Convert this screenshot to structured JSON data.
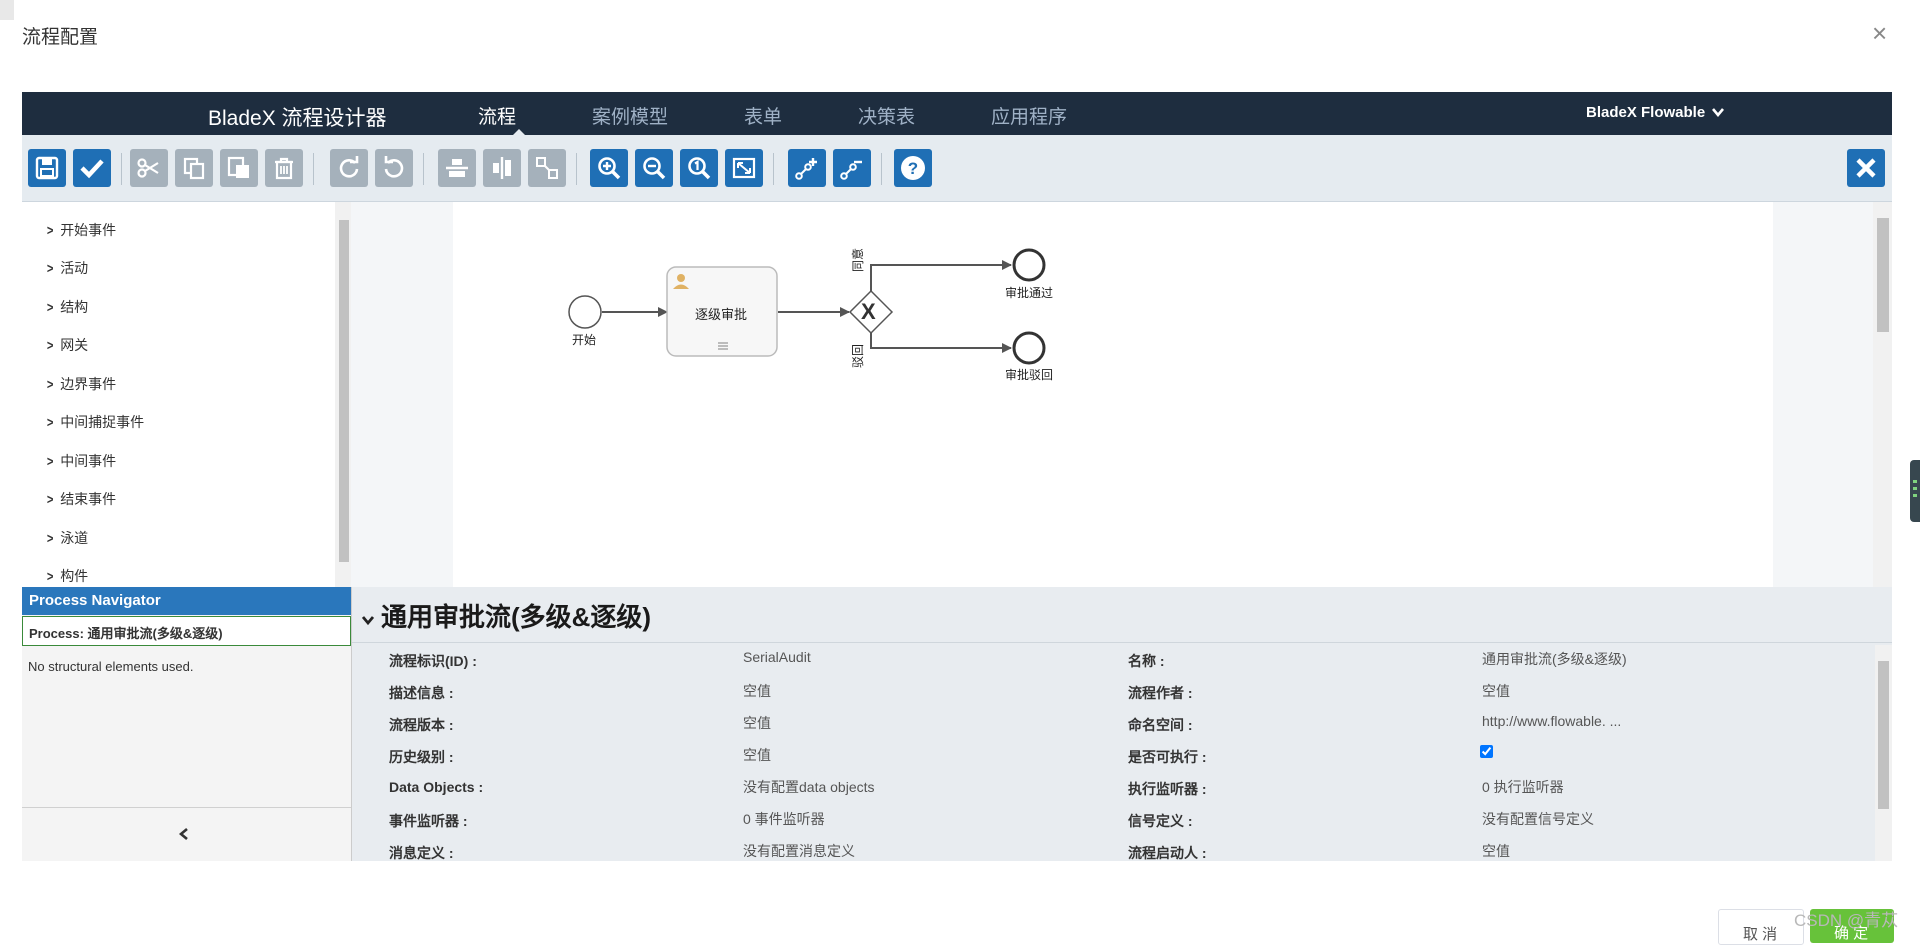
{
  "dialog": {
    "title": "流程配置",
    "close_symbol": "×"
  },
  "topnav": {
    "brand": "BladeX 流程设计器",
    "tabs": [
      {
        "label": "流程",
        "active": true
      },
      {
        "label": "案例模型",
        "active": false
      },
      {
        "label": "表单",
        "active": false
      },
      {
        "label": "决策表",
        "active": false
      },
      {
        "label": "应用程序",
        "active": false
      }
    ],
    "right_menu": "BladeX Flowable",
    "right_menu_icon": "chevron-down-icon"
  },
  "toolbar": {
    "buttons": [
      {
        "name": "save-icon",
        "state": "enabled"
      },
      {
        "name": "validate-check-icon",
        "state": "enabled"
      },
      {
        "name": "cut-icon",
        "state": "disabled"
      },
      {
        "name": "copy-icon",
        "state": "disabled"
      },
      {
        "name": "paste-icon",
        "state": "disabled"
      },
      {
        "name": "delete-icon",
        "state": "disabled"
      },
      {
        "name": "redo-icon",
        "state": "disabled"
      },
      {
        "name": "undo-icon",
        "state": "disabled"
      },
      {
        "name": "align-horizontal-icon",
        "state": "disabled"
      },
      {
        "name": "align-vertical-icon",
        "state": "disabled"
      },
      {
        "name": "same-size-icon",
        "state": "disabled"
      },
      {
        "name": "zoom-in-icon",
        "state": "enabled"
      },
      {
        "name": "zoom-out-icon",
        "state": "enabled"
      },
      {
        "name": "zoom-actual-icon",
        "state": "enabled"
      },
      {
        "name": "zoom-fit-icon",
        "state": "enabled"
      },
      {
        "name": "add-bendpoint-icon",
        "state": "enabled"
      },
      {
        "name": "remove-bendpoint-icon",
        "state": "enabled"
      },
      {
        "name": "help-icon",
        "state": "enabled"
      },
      {
        "name": "close-editor-icon",
        "state": "enabled"
      }
    ]
  },
  "palette": {
    "groups": [
      "开始事件",
      "活动",
      "结构",
      "网关",
      "边界事件",
      "中间捕捉事件",
      "中间事件",
      "结束事件",
      "泳道",
      "构件"
    ]
  },
  "diagram": {
    "start_label": "开始",
    "task_label": "逐级审批",
    "approve_flow_label": "同意",
    "reject_flow_label": "驳回",
    "end_approved_label": "审批通过",
    "end_rejected_label": "审批驳回",
    "gateway_symbol": "X"
  },
  "navigator": {
    "header": "Process Navigator",
    "process_label": "Process: 通用审批流(多级&逐级)",
    "empty_text": "No structural elements used.",
    "collapse_symbol": "‹"
  },
  "properties": {
    "title": "通用审批流(多级&逐级)",
    "left": [
      {
        "label": "流程标识(ID) :",
        "value": "SerialAudit"
      },
      {
        "label": "描述信息 :",
        "value": "空值"
      },
      {
        "label": "流程版本 :",
        "value": "空值"
      },
      {
        "label": "历史级别 :",
        "value": "空值"
      },
      {
        "label": "Data Objects :",
        "value": "没有配置data objects"
      },
      {
        "label": "事件监听器 :",
        "value": "0 事件监听器"
      },
      {
        "label": "消息定义 :",
        "value": "没有配置消息定义"
      }
    ],
    "right": [
      {
        "label": "名称 :",
        "value": "通用审批流(多级&逐级)"
      },
      {
        "label": "流程作者 :",
        "value": "空值"
      },
      {
        "label": "命名空间 :",
        "value": "http://www.flowable. ..."
      },
      {
        "label": "是否可执行 :",
        "checked": true
      },
      {
        "label": "执行监听器 :",
        "value": "0 执行监听器"
      },
      {
        "label": "信号定义 :",
        "value": "没有配置信号定义"
      },
      {
        "label": "流程启动人 :",
        "value": "空值"
      }
    ]
  },
  "footer": {
    "cancel": "取 消",
    "confirm": "确 定"
  },
  "watermark": "CSDN @青苁",
  "colors": {
    "nav_bg": "#1e2d3f",
    "toolbar_bg": "#e5ebf0",
    "btn_blue": "#1f6fb5",
    "btn_gray": "#a5b1bb",
    "navigator_head": "#2a77bc",
    "confirm_green": "#67c23a"
  }
}
